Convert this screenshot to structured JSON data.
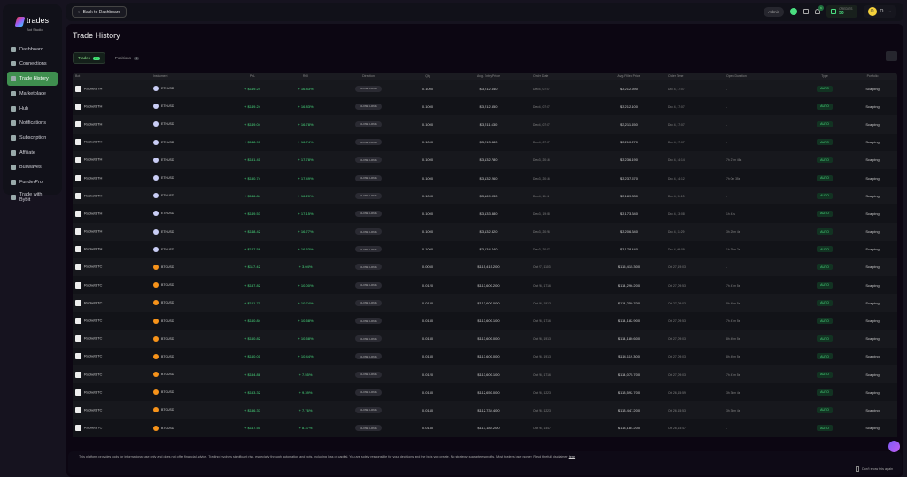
{
  "brand": {
    "name": "trades",
    "sub": "Bot Studio"
  },
  "sidebar": {
    "items": [
      {
        "label": "Dashboard"
      },
      {
        "label": "Connections"
      },
      {
        "label": "Trade History",
        "active": true
      },
      {
        "label": "Marketplace"
      },
      {
        "label": "Hub"
      },
      {
        "label": "Notifications"
      },
      {
        "label": "Subscription"
      },
      {
        "label": "Affiliate"
      },
      {
        "label": "Bullwaves"
      },
      {
        "label": "FunderPro"
      },
      {
        "label": "Trade with Bybit"
      }
    ]
  },
  "header": {
    "back_label": "Back to Dashboard",
    "role": "Admin",
    "notif_count": "6",
    "credits_label": "CREDITS",
    "credits_value": "50",
    "avatar_initial": "O",
    "user": "O."
  },
  "page": {
    "title": "Trade History",
    "tabs": [
      {
        "label": "Trades",
        "count": "20"
      },
      {
        "label": "Positions",
        "count": "0"
      }
    ]
  },
  "colors": {
    "accent": "#4ade80",
    "active_nav": "#3f8f4f"
  },
  "table": {
    "columns": [
      "Bot",
      "Instrument",
      "PnL",
      "ROI",
      "Direction",
      "Qty",
      "Avg. Entry Price",
      "Order Date",
      "Avg. Filled Price",
      "Order Time",
      "Open Duration",
      "Type",
      "Portfolio"
    ],
    "rows": [
      [
        "RocketETH",
        "ETHUSD",
        "+ $149.24",
        "+ 16.83%",
        "CLOSE LONG",
        "0.1000",
        "$3,212.640",
        "Dec 4, 07:07",
        "$3,212.690",
        "Dec 4, 17:07",
        "-",
        "AUTO",
        "Scalping"
      ],
      [
        "RocketETH",
        "ETHUSD",
        "+ $149.24",
        "+ 16.83%",
        "CLOSE LONG",
        "0.1000",
        "$3,212.550",
        "Dec 4, 07:07",
        "$3,212.100",
        "Dec 4, 17:07",
        "-",
        "AUTO",
        "Scalping"
      ],
      [
        "RocketETH",
        "ETHUSD",
        "+ $149.04",
        "+ 16.78%",
        "CLOSE LONG",
        "0.1000",
        "$3,211.630",
        "Dec 4, 07:07",
        "$3,211.650",
        "Dec 4, 17:07",
        "-",
        "AUTO",
        "Scalping"
      ],
      [
        "RocketETH",
        "ETHUSD",
        "+ $148.90",
        "+ 16.74%",
        "CLOSE LONG",
        "0.1000",
        "$3,213.380",
        "Dec 4, 07:07",
        "$3,210.270",
        "Dec 4, 17:07",
        "-",
        "AUTO",
        "Scalping"
      ],
      [
        "RocketETH",
        "ETHUSD",
        "+ $151.41",
        "+ 17.78%",
        "CLOSE LONG",
        "0.1000",
        "$3,132.780",
        "Dec 3, 20:16",
        "$3,236.190",
        "Dec 4, 14:14",
        "7h 27m 46s",
        "AUTO",
        "Scalping"
      ],
      [
        "RocketETH",
        "ETHUSD",
        "+ $150.74",
        "+ 17.49%",
        "CLOSE LONG",
        "0.1000",
        "$3,132.260",
        "Dec 3, 20:16",
        "$3,237.570",
        "Dec 4, 14:12",
        "7h 0m 35s",
        "AUTO",
        "Scalping"
      ],
      [
        "RocketETH",
        "ETHUSD",
        "+ $146.84",
        "+ 16.20%",
        "CLOSE LONG",
        "0.1000",
        "$3,169.930",
        "Dec 4, 11:11",
        "$3,189.330",
        "Dec 4, 11:13",
        "-",
        "AUTO",
        "Scalping"
      ],
      [
        "RocketETH",
        "ETHUSD",
        "+ $149.53",
        "+ 17.15%",
        "CLOSE LONG",
        "0.1000",
        "$3,133.380",
        "Dec 3, 19:08",
        "$3,173.340",
        "Dec 4, 13:08",
        "1h 41s",
        "AUTO",
        "Scalping"
      ],
      [
        "RocketETH",
        "ETHUSD",
        "+ $148.42",
        "+ 16.77%",
        "CLOSE LONG",
        "0.1000",
        "$3,132.320",
        "Dec 3, 20:26",
        "$3,206.340",
        "Dec 4, 11:29",
        "3h 25m 4s",
        "AUTO",
        "Scalping"
      ],
      [
        "RocketETH",
        "ETHUSD",
        "+ $147.56",
        "+ 16.53%",
        "CLOSE LONG",
        "0.1000",
        "$3,134.740",
        "Dec 3, 20:27",
        "$3,178.440",
        "Dec 4, 09:09",
        "1h 35m 2s",
        "AUTO",
        "Scalping"
      ],
      [
        "RocketBTC",
        "BTCUSD",
        "+ $117.42",
        "+ 3.04%",
        "CLOSE LONG",
        "0.0050",
        "$115,415.200",
        "Oct 27, 11:03",
        "$115,415.300",
        "Oct 27, 19:03",
        "-",
        "AUTO",
        "Scalping"
      ],
      [
        "RocketBTC",
        "BTCUSD",
        "+ $157.82",
        "+ 10.00%",
        "CLOSE LONG",
        "0.0120",
        "$113,600.200",
        "Oct 26, 17:16",
        "$114,296.200",
        "Oct 27, 09:53",
        "7h 47m 5s",
        "AUTO",
        "Scalping"
      ],
      [
        "RocketBTC",
        "BTCUSD",
        "+ $161.71",
        "+ 10.74%",
        "CLOSE LONG",
        "0.0130",
        "$113,600.000",
        "Oct 26, 19:13",
        "$114,250.700",
        "Oct 27, 09:03",
        "8h 49m 5s",
        "AUTO",
        "Scalping"
      ],
      [
        "RocketBTC",
        "BTCUSD",
        "+ $160.84",
        "+ 10.58%",
        "CLOSE LONG",
        "0.0130",
        "$113,600.100",
        "Oct 26, 17:16",
        "$114,182.900",
        "Oct 27, 09:53",
        "7h 47m 5s",
        "AUTO",
        "Scalping"
      ],
      [
        "RocketBTC",
        "BTCUSD",
        "+ $160.82",
        "+ 10.58%",
        "CLOSE LONG",
        "0.0130",
        "$113,600.000",
        "Oct 26, 19:13",
        "$114,180.600",
        "Oct 27, 09:03",
        "8h 49m 5s",
        "AUTO",
        "Scalping"
      ],
      [
        "RocketBTC",
        "BTCUSD",
        "+ $160.01",
        "+ 10.44%",
        "CLOSE LONG",
        "0.0130",
        "$113,600.000",
        "Oct 26, 19:13",
        "$114,119.300",
        "Oct 27, 09:03",
        "8h 49m 5s",
        "AUTO",
        "Scalping"
      ],
      [
        "RocketBTC",
        "BTCUSD",
        "+ $154.88",
        "+ 7.55%",
        "CLOSE LONG",
        "0.0120",
        "$113,600.100",
        "Oct 26, 17:16",
        "$114,075.700",
        "Oct 27, 09:03",
        "7h 47m 5s",
        "AUTO",
        "Scalping"
      ],
      [
        "RocketBTC",
        "BTCUSD",
        "+ $153.32",
        "+ 9.39%",
        "CLOSE LONG",
        "0.0130",
        "$112,650.000",
        "Oct 26, 12:23",
        "$113,592.700",
        "Oct 26, 15:59",
        "3h 36m 4s",
        "AUTO",
        "Scalping"
      ],
      [
        "RocketBTC",
        "BTCUSD",
        "+ $156.37",
        "+ 7.76%",
        "CLOSE LONG",
        "0.0140",
        "$112,734.400",
        "Oct 26, 12:23",
        "$113,447.200",
        "Oct 26, 15:53",
        "3h 30m 4s",
        "AUTO",
        "Scalping"
      ],
      [
        "RocketBTC",
        "BTCUSD",
        "+ $147.50",
        "+ 8.37%",
        "CLOSE LONG",
        "0.0130",
        "$113,184.200",
        "Oct 26, 14:47",
        "$113,184.200",
        "Oct 26, 14:47",
        "-",
        "AUTO",
        "Scalping"
      ]
    ]
  },
  "disclaimer": {
    "text": "This platform provides tools for informational use only and does not offer financial advice. Trading involves significant risk, especially through automation and bots, including loss of capital. You are solely responsible for your decisions and the bots you create. No strategy guarantees profits. Most traders lose money. Read the full disclaimer",
    "link": "here",
    "dont_show": "Don't show this again"
  }
}
